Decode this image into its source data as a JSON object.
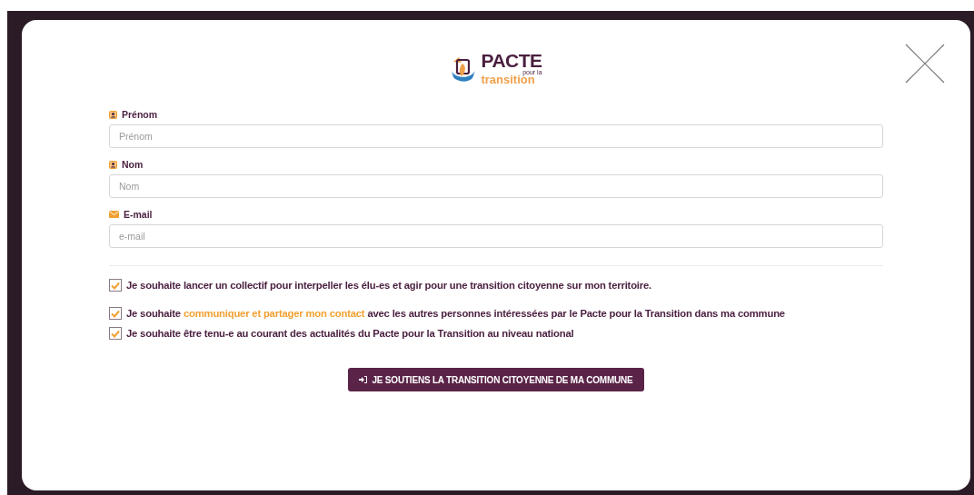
{
  "logo": {
    "title": "PACTE",
    "small": "pour la",
    "subtitle": "transition"
  },
  "fields": [
    {
      "label": "Prénom",
      "kind": "person",
      "placeholder": "Prénom"
    },
    {
      "label": "Nom",
      "kind": "person",
      "placeholder": "Nom"
    },
    {
      "label": "E-mail",
      "kind": "mail",
      "placeholder": "e-mail"
    }
  ],
  "options": [
    {
      "checked": true,
      "parts": [
        {
          "kind": "text",
          "text": "Je souhaite lancer un collectif pour interpeller les élu-es et agir pour une transition citoyenne sur mon territoire."
        }
      ]
    },
    {
      "checked": true,
      "parts": [
        {
          "kind": "text",
          "text": "Je souhaite "
        },
        {
          "kind": "link",
          "text": "communiquer et partager mon contact"
        },
        {
          "kind": "text",
          "text": " avec les autres personnes intéressées par le Pacte pour la Transition dans ma commune"
        }
      ]
    },
    {
      "checked": true,
      "parts": [
        {
          "kind": "text",
          "text": "Je souhaite être tenu-e au courant des actualités du Pacte pour la Transition au niveau national"
        }
      ]
    }
  ],
  "submit": {
    "label": "JE SOUTIENS LA TRANSITION CITOYENNE DE MA COMMUNE"
  }
}
